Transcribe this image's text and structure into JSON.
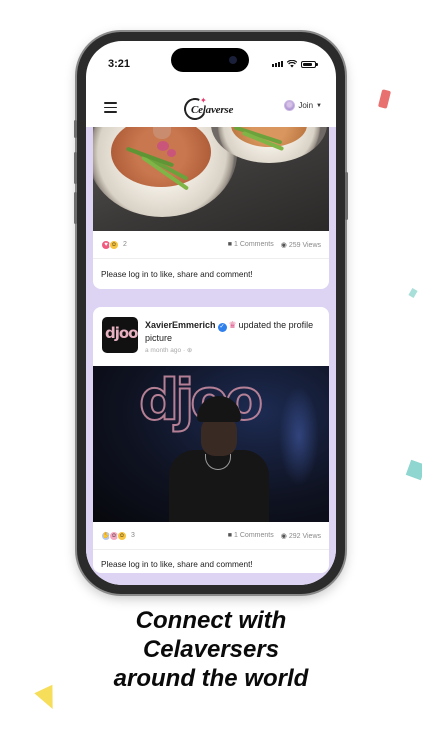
{
  "status_bar": {
    "time": "3:21"
  },
  "app_bar": {
    "logo_text": "Celaverse",
    "join_label": "Join"
  },
  "posts": [
    {
      "reaction_count": "2",
      "comments": "1 Comments",
      "views": "259 Views",
      "login_note": "Please log in to like, share and comment!"
    },
    {
      "author": "XavierEmmerich",
      "action": "updated the profile picture",
      "meta": "a month ago ·",
      "avatar_text": "djoo",
      "photo_sign": "djoo",
      "reaction_count": "3",
      "comments": "1 Comments",
      "views": "292 Views",
      "login_note": "Please log in to like, share and comment!"
    }
  ],
  "caption": {
    "line1": "Connect with",
    "line2": "Celaversers",
    "line3": "around the world"
  },
  "colors": {
    "feed_background": "#ddd3f2",
    "accent_pink": "#e6396c",
    "verified_blue": "#2f80ed"
  },
  "icons": [
    "hamburger-icon",
    "chevron-down-icon",
    "comment-icon",
    "eye-icon",
    "verified-icon",
    "crown-icon",
    "globe-icon",
    "heart-reaction-icon",
    "smile-reaction-icon"
  ]
}
